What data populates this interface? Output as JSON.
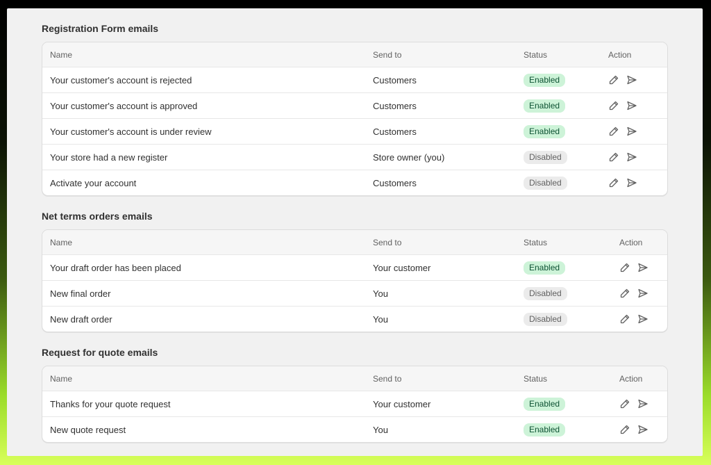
{
  "columns": {
    "name": "Name",
    "send_to": "Send to",
    "status": "Status",
    "action": "Action"
  },
  "colors": {
    "enabled_bg": "#cdf3d8",
    "enabled_text": "#0c5132",
    "disabled_bg": "#ebebeb",
    "disabled_text": "#616161"
  },
  "icons": {
    "edit": "pencil-icon",
    "send": "send-icon"
  },
  "sections": [
    {
      "title": "Registration Form emails",
      "rows": [
        {
          "name": "Your customer's account is rejected",
          "send_to": "Customers",
          "status": "Enabled"
        },
        {
          "name": "Your customer's account is approved",
          "send_to": "Customers",
          "status": "Enabled"
        },
        {
          "name": "Your customer's account is under review",
          "send_to": "Customers",
          "status": "Enabled"
        },
        {
          "name": "Your store had a new register",
          "send_to": "Store owner (you)",
          "status": "Disabled"
        },
        {
          "name": "Activate your account",
          "send_to": "Customers",
          "status": "Disabled"
        }
      ]
    },
    {
      "title": "Net terms orders emails",
      "rows": [
        {
          "name": "Your draft order has been placed",
          "send_to": "Your customer",
          "status": "Enabled"
        },
        {
          "name": "New final order",
          "send_to": "You",
          "status": "Disabled"
        },
        {
          "name": "New draft order",
          "send_to": "You",
          "status": "Disabled"
        }
      ]
    },
    {
      "title": "Request for quote emails",
      "rows": [
        {
          "name": "Thanks for your quote request",
          "send_to": "Your customer",
          "status": "Enabled"
        },
        {
          "name": "New quote request",
          "send_to": "You",
          "status": "Enabled"
        }
      ]
    }
  ]
}
